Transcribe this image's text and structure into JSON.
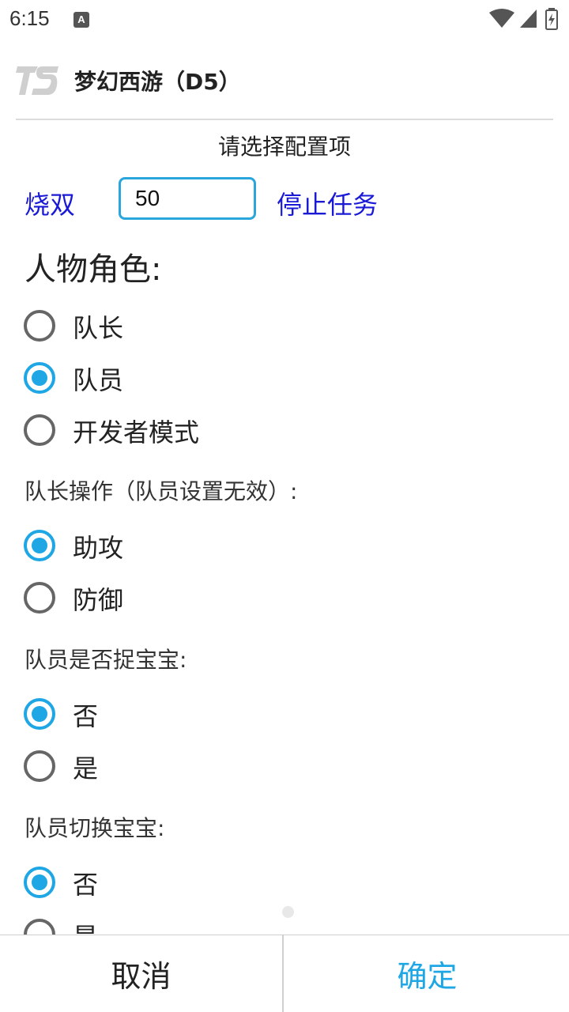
{
  "status_bar": {
    "time": "6:15",
    "notification_icon": "a-notification-icon",
    "icons": [
      "wifi-icon",
      "cell-signal-icon",
      "battery-charging-icon"
    ]
  },
  "header": {
    "logo_icon": "ts-logo-icon",
    "title": "梦幻西游（D5）"
  },
  "subtitle": "请选择配置项",
  "top_row": {
    "left_link": "烧双",
    "input_value": "50",
    "right_link": "停止任务"
  },
  "sections": {
    "role": {
      "heading": "人物角色:",
      "options": [
        {
          "label": "队长",
          "checked": false
        },
        {
          "label": "队员",
          "checked": true
        },
        {
          "label": "开发者模式",
          "checked": false
        }
      ]
    },
    "leader_action": {
      "heading": "队长操作（队员设置无效）:",
      "options": [
        {
          "label": "助攻",
          "checked": true
        },
        {
          "label": "防御",
          "checked": false
        }
      ]
    },
    "catch_pet": {
      "heading": "队员是否捉宝宝:",
      "options": [
        {
          "label": "否",
          "checked": true
        },
        {
          "label": "是",
          "checked": false
        }
      ]
    },
    "switch_pet": {
      "heading": "队员切换宝宝:",
      "options": [
        {
          "label": "否",
          "checked": true
        },
        {
          "label": "是",
          "checked": false
        }
      ]
    }
  },
  "buttons": {
    "cancel": "取消",
    "confirm": "确定"
  },
  "colors": {
    "accent": "#1ea7e4",
    "link": "#1a1ad6",
    "input_border": "#2aa6dc"
  }
}
